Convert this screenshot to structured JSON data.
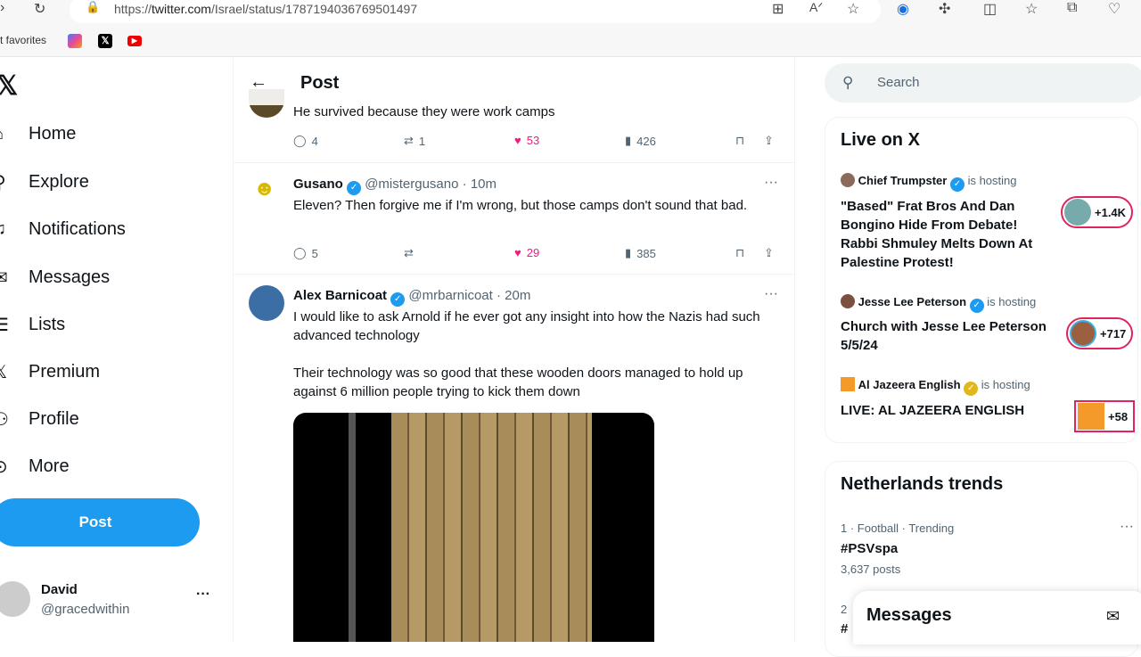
{
  "browser": {
    "url_prefix": "https://",
    "url_domain": "twitter.com",
    "url_path": "/Israel/status/1787194036769501497",
    "favorites_label": "t favorites"
  },
  "sidebar": {
    "items": [
      {
        "label": "Home",
        "icon": "home-icon"
      },
      {
        "label": "Explore",
        "icon": "search-icon"
      },
      {
        "label": "Notifications",
        "icon": "bell-icon"
      },
      {
        "label": "Messages",
        "icon": "mail-icon"
      },
      {
        "label": "Lists",
        "icon": "list-icon"
      },
      {
        "label": "Premium",
        "icon": "x-icon"
      },
      {
        "label": "Profile",
        "icon": "person-icon"
      },
      {
        "label": "More",
        "icon": "more-icon"
      }
    ],
    "post_label": "Post",
    "user": {
      "name": "David",
      "handle": "@gracedwithin"
    }
  },
  "main": {
    "title": "Post",
    "tweets": [
      {
        "text": "He survived because they were work camps",
        "replies": "4",
        "retweets": "1",
        "likes": "53",
        "views": "426"
      },
      {
        "name": "Gusano",
        "handle": "@mistergusano",
        "time": "10m",
        "text": "Eleven? Then forgive me if I'm wrong, but those camps don't sound that bad.",
        "replies": "5",
        "retweets": "",
        "likes": "29",
        "views": "385"
      },
      {
        "name": "Alex Barnicoat",
        "handle": "@mrbarnicoat",
        "time": "20m",
        "text1": "I would like to ask Arnold if he ever got any insight into how the Nazis had such advanced technology",
        "text2": "Their technology was so good that these wooden doors managed to hold up against 6 million people trying to kick them down"
      }
    ]
  },
  "right": {
    "search_placeholder": "Search",
    "live": {
      "title": "Live on X",
      "items": [
        {
          "host": "Chief Trumpster",
          "hosting": "is hosting",
          "title": "\"Based\" Frat Bros And Dan Bongino Hide From Debate! Rabbi Shmuley Melts Down At Palestine Protest!",
          "count": "+1.4K"
        },
        {
          "host": "Jesse Lee Peterson",
          "hosting": "is hosting",
          "title": "Church with Jesse Lee Peterson 5/5/24",
          "count": "+717"
        },
        {
          "host": "Al Jazeera English",
          "hosting": "is hosting",
          "title": "LIVE: AL JAZEERA ENGLISH",
          "count": "+58"
        }
      ]
    },
    "trends": {
      "title": "Netherlands trends",
      "items": [
        {
          "meta": "1 · Football · Trending",
          "tag": "#PSVspa",
          "posts": "3,637 posts"
        },
        {
          "meta": "2",
          "tag": "#"
        }
      ]
    },
    "messages_label": "Messages"
  },
  "colors": {
    "accent": "#1d9bf0",
    "like": "#f91880",
    "live_border": "#e0245e"
  }
}
